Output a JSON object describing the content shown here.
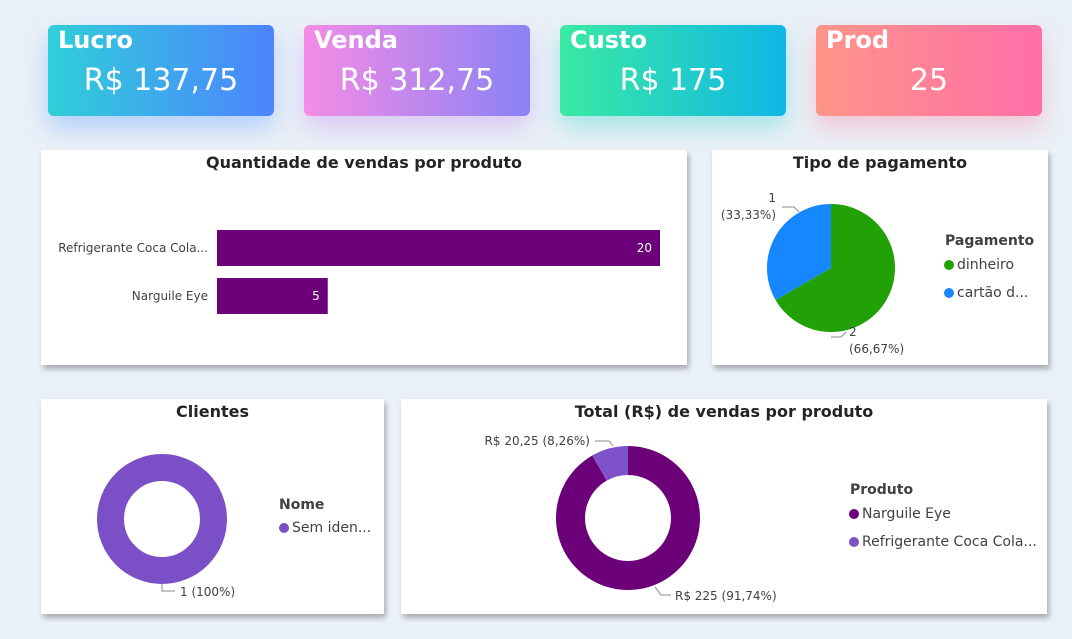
{
  "kpis": {
    "lucro": {
      "label": "Lucro",
      "value": "R$ 137,75"
    },
    "venda": {
      "label": "Venda",
      "value": "R$ 312,75"
    },
    "custo": {
      "label": "Custo",
      "value": "R$ 175"
    },
    "prod": {
      "label": "Prod",
      "value": "25"
    }
  },
  "colors": {
    "bar": "#6b0078",
    "dinheiro": "#22a106",
    "cartao": "#1787ff",
    "narguile": "#6b0078",
    "refrigerante": "#7e52c9",
    "clientes": "#7b4fc6"
  },
  "chart_data": [
    {
      "type": "bar",
      "orientation": "horizontal",
      "title": "Quantidade de vendas por produto",
      "categories": [
        "Refrigerante Coca Cola...",
        "Narguile Eye"
      ],
      "values": [
        20,
        5
      ],
      "data_labels": [
        "20",
        "5"
      ]
    },
    {
      "type": "pie",
      "title": "Tipo de pagamento",
      "legend_title": "Pagamento",
      "legend_position": "right",
      "labels": [
        "dinheiro",
        "cartão d..."
      ],
      "values": [
        2,
        1
      ],
      "data_labels": [
        {
          "value": "2",
          "percent": "(66,67%)"
        },
        {
          "value": "1",
          "percent": "(33,33%)"
        }
      ]
    },
    {
      "type": "pie",
      "donut": true,
      "title": "Clientes",
      "legend_title": "Nome",
      "legend_position": "right",
      "labels": [
        "Sem iden..."
      ],
      "values": [
        1
      ],
      "data_labels": [
        "1 (100%)"
      ]
    },
    {
      "type": "pie",
      "donut": true,
      "title": "Total (R$) de vendas por produto",
      "legend_title": "Produto",
      "legend_position": "right",
      "labels": [
        "Narguile Eye",
        "Refrigerante Coca Cola..."
      ],
      "values": [
        225,
        20.25
      ],
      "data_labels": [
        "R$ 225 (91,74%)",
        "R$ 20,25 (8,26%)"
      ]
    }
  ]
}
